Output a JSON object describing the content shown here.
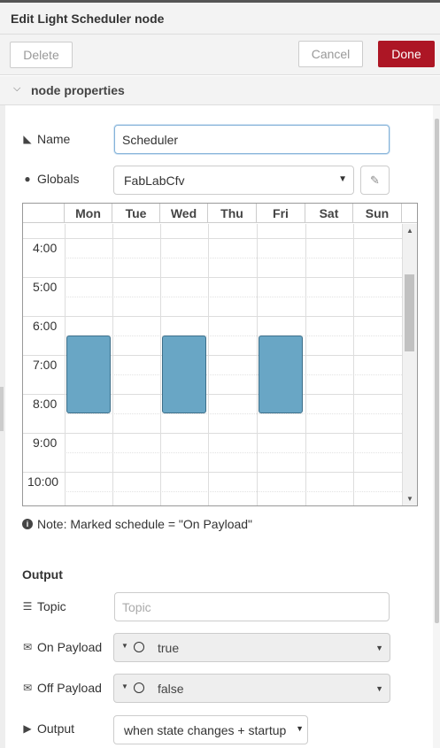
{
  "header": {
    "title": "Edit Light Scheduler node"
  },
  "toolbar": {
    "delete_label": "Delete",
    "cancel_label": "Cancel",
    "done_label": "Done"
  },
  "section": {
    "label": "node properties"
  },
  "fields": {
    "name": {
      "label": "Name",
      "value": "Scheduler"
    },
    "globals": {
      "label": "Globals",
      "value": "FabLabCfv"
    }
  },
  "scheduler": {
    "days": [
      "Mon",
      "Tue",
      "Wed",
      "Thu",
      "Fri",
      "Sat",
      "Sun"
    ],
    "times": [
      "4:00",
      "5:00",
      "6:00",
      "7:00",
      "8:00",
      "9:00",
      "10:00"
    ],
    "blocks": [
      {
        "day": "Mon",
        "start": "6:30",
        "end": "8:30"
      },
      {
        "day": "Wed",
        "start": "6:30",
        "end": "8:30"
      },
      {
        "day": "Fri",
        "start": "6:30",
        "end": "8:30"
      }
    ],
    "block_color": "#69a6c5"
  },
  "note": "Note: Marked schedule = \"On Payload\"",
  "output_section": {
    "title": "Output",
    "topic": {
      "label": "Topic",
      "placeholder": "Topic"
    },
    "on_payload": {
      "label": "On Payload",
      "value": "true"
    },
    "off_payload": {
      "label": "Off Payload",
      "value": "false"
    },
    "output": {
      "label": "Output",
      "value": "when state changes + startup"
    }
  },
  "colors": {
    "done": "#ad1625",
    "focus": "#85b3d9"
  }
}
